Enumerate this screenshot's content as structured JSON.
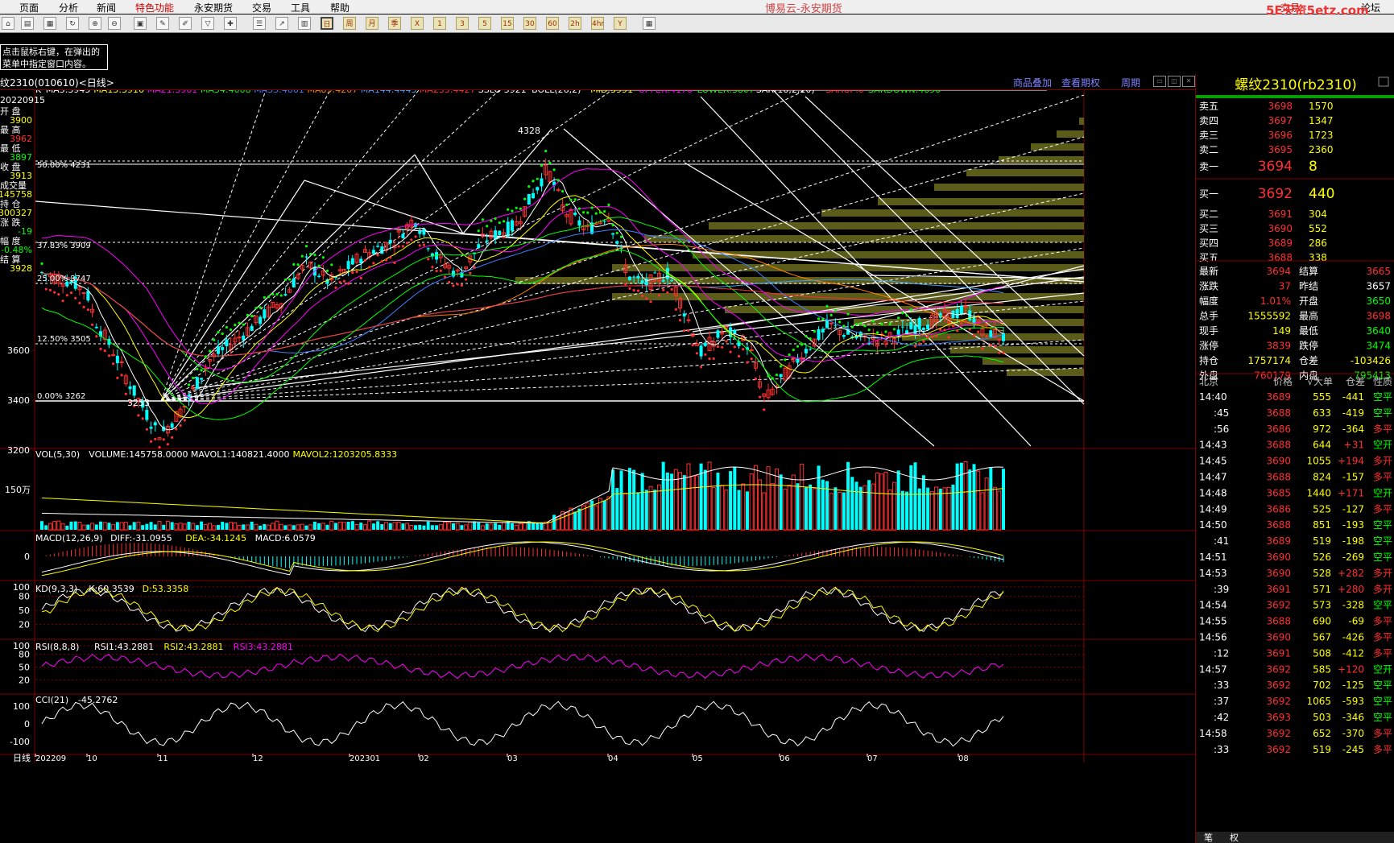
{
  "menu": {
    "items": [
      "页面",
      "分析",
      "新闻",
      "特色功能",
      "永安期货",
      "交易",
      "工具",
      "帮助"
    ],
    "app_title": "博易云-永安期货",
    "right_items": [
      "交易",
      "论坛"
    ],
    "watermark": "5E天资5etz.com"
  },
  "toolbar": {
    "periods": [
      "日",
      "周",
      "月",
      "季",
      "X",
      "1",
      "3",
      "5",
      "15",
      "30",
      "60",
      "2h",
      "4hr",
      "Y"
    ]
  },
  "tip": {
    "line1": "点击鼠标右键，在弹出的",
    "line2": "菜单中指定窗口内容。"
  },
  "chart_header": {
    "symbol": "纹2310(010610)<日线>",
    "links": [
      "商品叠加",
      "查看期权",
      "周期"
    ]
  },
  "main_indicators": [
    {
      "text": "K",
      "color": "#ffffff"
    },
    {
      "text": "MA5:3945",
      "color": "#ffffff"
    },
    {
      "text": "MA13:3916",
      "color": "#ffff00"
    },
    {
      "text": "MA21:3961",
      "color": "#ff00ff"
    },
    {
      "text": "MA34:4008",
      "color": "#00ff00"
    },
    {
      "text": "MA55:4001",
      "color": "#4080ff"
    },
    {
      "text": "MA89:4207",
      "color": "#ff8000"
    },
    {
      "text": "MA144:4443",
      "color": "#40a0ff"
    },
    {
      "text": "MA233:4427",
      "color": "#ff3030"
    },
    {
      "text": "SSLO 3921",
      "color": "#ffffff"
    },
    {
      "text": "BOLL(26,2)",
      "color": "#ffffff"
    },
    {
      "text": "MID:3991",
      "color": "#ffff00"
    },
    {
      "text": "UPPER:4176",
      "color": "#ff00ff"
    },
    {
      "text": "LOWER:3807",
      "color": "#00ff00"
    },
    {
      "text": "SAR(10,2,20)",
      "color": "#ffffff"
    },
    {
      "text": "SARUP:0",
      "color": "#ff3030"
    },
    {
      "text": "SARDOWN:4090",
      "color": "#00ff00"
    }
  ],
  "left_info": {
    "date": "20220915",
    "rows": [
      {
        "label": "开 盘",
        "value": "3900",
        "color": "#ffff00"
      },
      {
        "label": "最 高",
        "value": "3962",
        "color": "#ff3030"
      },
      {
        "label": "最 低",
        "value": "3897",
        "color": "#00ff00"
      },
      {
        "label": "收 盘",
        "value": "3913",
        "color": "#ffff00"
      },
      {
        "label": "成交量",
        "value": "145758",
        "color": "#ffff00"
      },
      {
        "label": "持 仓",
        "value": "300327",
        "color": "#ffff00"
      },
      {
        "label": "涨 跌",
        "value": "-19",
        "color": "#00ff00"
      },
      {
        "label": "幅 度",
        "value": "-0.48%",
        "color": "#00ff00"
      },
      {
        "label": "结 算",
        "value": "3928",
        "color": "#ffff00"
      }
    ]
  },
  "price_axis": [
    "3600",
    "3400",
    "3200"
  ],
  "fib_levels": [
    {
      "label": "50.00% 4231",
      "price": 4231
    },
    {
      "label": "37.83% 3909",
      "price": 3909
    },
    {
      "label": "25.00% 3747",
      "price": 3747
    },
    {
      "label": "12.50% 3505",
      "price": 3505
    },
    {
      "label": "0.00% 3262",
      "price": 3262
    }
  ],
  "price_annotations": [
    "4328",
    "3253"
  ],
  "volume_panel": {
    "header": [
      {
        "text": "VOL(5,30)",
        "color": "#ffffff"
      },
      {
        "text": "VOLUME:145758.0000",
        "color": "#ffffff"
      },
      {
        "text": "MAVOL1:140821.4000",
        "color": "#ffffff"
      },
      {
        "text": "MAVOL2:1203205.8333",
        "color": "#ffff00"
      }
    ],
    "axis": "150万"
  },
  "macd_panel": {
    "header": [
      {
        "text": "MACD(12,26,9)",
        "color": "#ffffff"
      },
      {
        "text": "DIFF:-31.0955",
        "color": "#ffffff"
      },
      {
        "text": "DEA:-34.1245",
        "color": "#ffff00"
      },
      {
        "text": "MACD:6.0579",
        "color": "#ffffff"
      }
    ],
    "axis": [
      "0"
    ]
  },
  "kd_panel": {
    "header": [
      {
        "text": "KD(9,3,3)",
        "color": "#ffffff"
      },
      {
        "text": "K:60.3539",
        "color": "#ffffff"
      },
      {
        "text": "D:53.3358",
        "color": "#ffff00"
      }
    ],
    "axis": [
      "100",
      "80",
      "50",
      "20"
    ]
  },
  "rsi_panel": {
    "header": [
      {
        "text": "RSI(8,8,8)",
        "color": "#ffffff"
      },
      {
        "text": "RSI1:43.2881",
        "color": "#ffffff"
      },
      {
        "text": "RSI2:43.2881",
        "color": "#ffff00"
      },
      {
        "text": "RSI3:43.2881",
        "color": "#ff00ff"
      }
    ],
    "axis": [
      "100",
      "80",
      "50",
      "20"
    ]
  },
  "cci_panel": {
    "header": [
      {
        "text": "CCI(21)",
        "color": "#ffffff"
      },
      {
        "text": "-45.2762",
        "color": "#ffffff"
      }
    ],
    "axis": [
      "100",
      "0",
      "-100"
    ]
  },
  "x_axis": {
    "label": "日线",
    "ticks": [
      "202209",
      "10",
      "11",
      "12",
      "202301",
      "02",
      "03",
      "04",
      "05",
      "06",
      "07",
      "08"
    ]
  },
  "quote_panel": {
    "title": "螺纹2310(rb2310)",
    "asks": [
      {
        "label": "卖五",
        "price": "3698",
        "vol": "1570"
      },
      {
        "label": "卖四",
        "price": "3697",
        "vol": "1347"
      },
      {
        "label": "卖三",
        "price": "3696",
        "vol": "1723"
      },
      {
        "label": "卖二",
        "price": "3695",
        "vol": "2360"
      }
    ],
    "ask1": {
      "label": "卖一",
      "price": "3694",
      "vol": "8"
    },
    "bid1": {
      "label": "买一",
      "price": "3692",
      "vol": "440"
    },
    "bids": [
      {
        "label": "买二",
        "price": "3691",
        "vol": "304"
      },
      {
        "label": "买三",
        "price": "3690",
        "vol": "552"
      },
      {
        "label": "买四",
        "price": "3689",
        "vol": "286"
      },
      {
        "label": "买五",
        "price": "3688",
        "vol": "338"
      }
    ],
    "stats": [
      {
        "l1": "最新",
        "v1": "3694",
        "c1": "#ff3030",
        "l2": "结算",
        "v2": "3665",
        "c2": "#ff3030"
      },
      {
        "l1": "涨跌",
        "v1": "37",
        "c1": "#ff3030",
        "l2": "昨结",
        "v2": "3657",
        "c2": "#ffffff"
      },
      {
        "l1": "幅度",
        "v1": "1.01%",
        "c1": "#ff3030",
        "l2": "开盘",
        "v2": "3650",
        "c2": "#00ff00"
      },
      {
        "l1": "总手",
        "v1": "1555592",
        "c1": "#ffff00",
        "l2": "最高",
        "v2": "3698",
        "c2": "#ff3030"
      },
      {
        "l1": "现手",
        "v1": "149",
        "c1": "#ffff00",
        "l2": "最低",
        "v2": "3640",
        "c2": "#00ff00"
      },
      {
        "l1": "涨停",
        "v1": "3839",
        "c1": "#ff3030",
        "l2": "跌停",
        "v2": "3474",
        "c2": "#00ff00"
      },
      {
        "l1": "持仓",
        "v1": "1757174",
        "c1": "#ffff00",
        "l2": "仓差",
        "v2": "-103426",
        "c2": "#ffff00"
      },
      {
        "l1": "外盘",
        "v1": "760179",
        "c1": "#ff3030",
        "l2": "内盘",
        "v2": "795413",
        "c2": "#00ff00"
      }
    ],
    "ticks_header": [
      "北京",
      "价格",
      "√大单",
      "仓差",
      "性质"
    ],
    "ticks": [
      {
        "t": "14:40",
        "p": "3689",
        "v": "555",
        "d": "-441",
        "n": "空平",
        "nc": "#00ff00"
      },
      {
        "t": ":45",
        "p": "3688",
        "v": "633",
        "d": "-419",
        "n": "空平",
        "nc": "#00ff00"
      },
      {
        "t": ":56",
        "p": "3686",
        "v": "972",
        "d": "-364",
        "n": "多平",
        "nc": "#ff3030"
      },
      {
        "t": "14:43",
        "p": "3688",
        "v": "644",
        "d": "+31",
        "n": "空开",
        "nc": "#00ff00"
      },
      {
        "t": "14:45",
        "p": "3690",
        "v": "1055",
        "d": "+194",
        "n": "多开",
        "nc": "#ff3030"
      },
      {
        "t": "14:47",
        "p": "3688",
        "v": "824",
        "d": "-157",
        "n": "多平",
        "nc": "#ff3030"
      },
      {
        "t": "14:48",
        "p": "3685",
        "v": "1440",
        "d": "+171",
        "n": "空开",
        "nc": "#00ff00"
      },
      {
        "t": "14:49",
        "p": "3686",
        "v": "525",
        "d": "-127",
        "n": "多平",
        "nc": "#ff3030"
      },
      {
        "t": "14:50",
        "p": "3688",
        "v": "851",
        "d": "-193",
        "n": "空平",
        "nc": "#00ff00"
      },
      {
        "t": ":41",
        "p": "3689",
        "v": "519",
        "d": "-198",
        "n": "空平",
        "nc": "#00ff00"
      },
      {
        "t": "14:51",
        "p": "3690",
        "v": "526",
        "d": "-269",
        "n": "空平",
        "nc": "#00ff00"
      },
      {
        "t": "14:53",
        "p": "3690",
        "v": "528",
        "d": "+282",
        "n": "多开",
        "nc": "#ff3030"
      },
      {
        "t": ":39",
        "p": "3691",
        "v": "571",
        "d": "+280",
        "n": "多开",
        "nc": "#ff3030"
      },
      {
        "t": "14:54",
        "p": "3692",
        "v": "573",
        "d": "-328",
        "n": "空平",
        "nc": "#00ff00"
      },
      {
        "t": "14:55",
        "p": "3688",
        "v": "690",
        "d": "-69",
        "n": "多平",
        "nc": "#ff3030"
      },
      {
        "t": "14:56",
        "p": "3690",
        "v": "567",
        "d": "-426",
        "n": "多平",
        "nc": "#ff3030"
      },
      {
        "t": ":12",
        "p": "3691",
        "v": "508",
        "d": "-412",
        "n": "多平",
        "nc": "#ff3030"
      },
      {
        "t": "14:57",
        "p": "3692",
        "v": "585",
        "d": "+120",
        "n": "空开",
        "nc": "#00ff00"
      },
      {
        "t": ":33",
        "p": "3692",
        "v": "702",
        "d": "-125",
        "n": "空平",
        "nc": "#00ff00"
      },
      {
        "t": ":37",
        "p": "3692",
        "v": "1065",
        "d": "-593",
        "n": "空平",
        "nc": "#00ff00"
      },
      {
        "t": ":42",
        "p": "3693",
        "v": "503",
        "d": "-346",
        "n": "空平",
        "nc": "#00ff00"
      },
      {
        "t": "14:58",
        "p": "3692",
        "v": "652",
        "d": "-370",
        "n": "多平",
        "nc": "#ff3030"
      },
      {
        "t": ":33",
        "p": "3692",
        "v": "519",
        "d": "-245",
        "n": "多平",
        "nc": "#ff3030"
      }
    ],
    "bottom_tabs": [
      "笔",
      "权"
    ]
  },
  "colors": {
    "up": "#ff3030",
    "down": "#00ffff",
    "grid": "#800000",
    "volume_profile": "#6b6b1f"
  }
}
